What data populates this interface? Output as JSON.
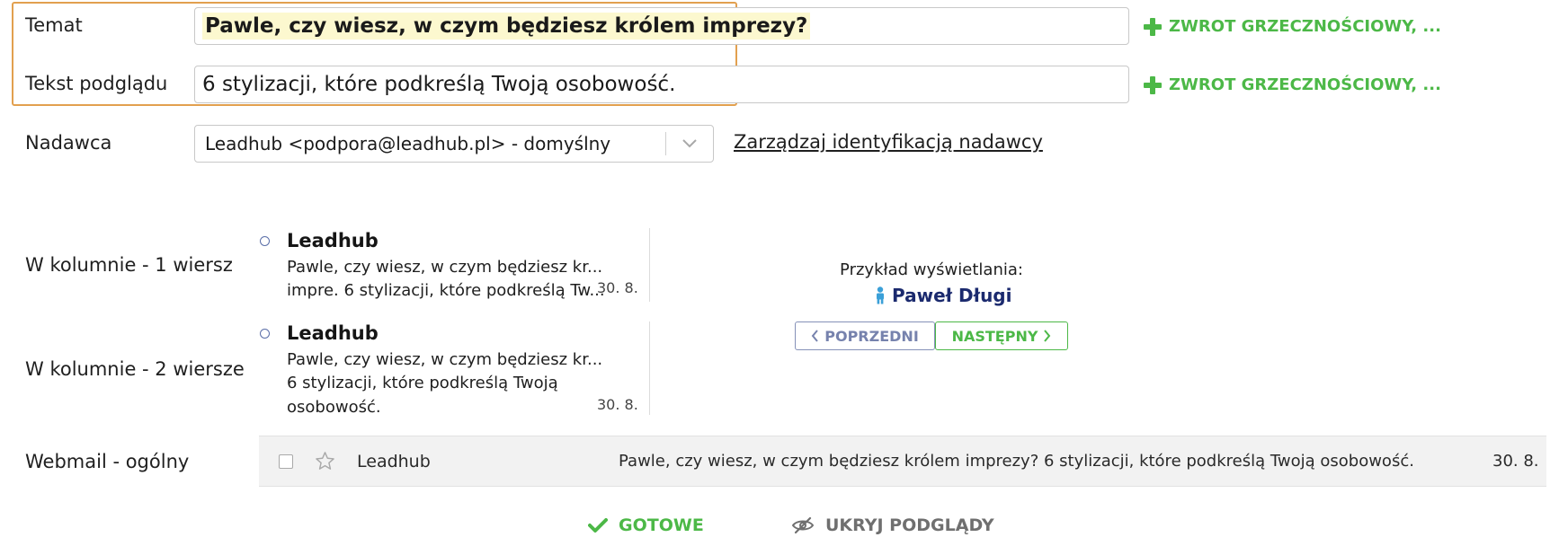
{
  "form": {
    "subject_label": "Temat",
    "subject_value": "Pawle, czy wiesz, w czym będziesz królem imprezy?",
    "preview_label": "Tekst podglądu",
    "preview_value": "6 stylizacji, które podkreślą Twoją osobowość.",
    "add_greeting_label": "ZWROT GRZECZNOŚCIOWY, ...",
    "sender_label": "Nadawca",
    "sender_value": "Leadhub <podpora@leadhub.pl> - domyślny",
    "manage_sender_link": "Zarządzaj identyfikacją nadawcy"
  },
  "previews": {
    "one_line": {
      "label": "W kolumnie - 1 wiersz",
      "sender": "Leadhub",
      "line1": "Pawle, czy wiesz, w czym będziesz kr...",
      "line2": "impre. 6 stylizacji, które podkreślą Tw...",
      "date": "30. 8."
    },
    "two_lines": {
      "label": "W kolumnie - 2 wiersze",
      "sender": "Leadhub",
      "line1": "Pawle, czy wiesz, w czym będziesz kr...",
      "line2": "6 stylizacji, które podkreślą Twoją",
      "line3": "osobowość.",
      "date": "30. 8."
    },
    "webmail": {
      "label": "Webmail - ogólny",
      "sender": "Leadhub",
      "text": "Pawle, czy wiesz, w czym będziesz królem imprezy? 6 stylizacji, które podkreślą Twoją osobowość.",
      "date": "30. 8."
    }
  },
  "example": {
    "label": "Przykład wyświetlania:",
    "name": "Paweł Długi",
    "prev_button": "POPRZEDNI",
    "next_button": "NASTĘPNY"
  },
  "actions": {
    "done_button": "GOTOWE",
    "hide_previews_button": "UKRYJ PODGLĄDY"
  },
  "colors": {
    "accent_green": "#4cb847",
    "highlight_border": "#e2a04f",
    "subject_highlight": "#fcf8cf",
    "name_blue": "#1b2a6e",
    "person_icon": "#3ba0d8"
  }
}
